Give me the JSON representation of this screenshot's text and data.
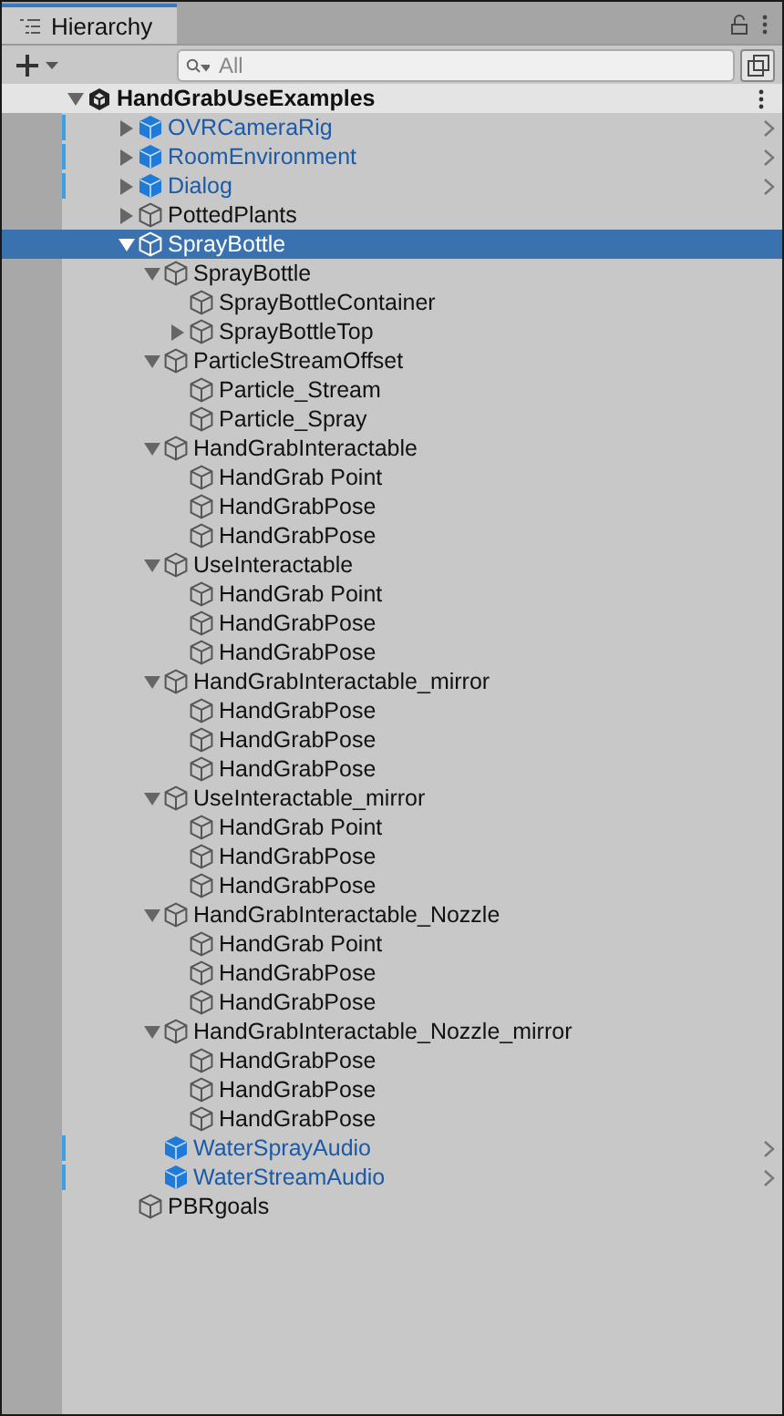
{
  "tab": {
    "title": "Hierarchy",
    "selected": true
  },
  "toolbar": {
    "search_placeholder": "All"
  },
  "scene": {
    "name": "HandGrabUseExamples",
    "expanded": true,
    "items": [
      {
        "name": "OVRCameraRig",
        "kind": "prefab",
        "expanded": false,
        "selected": false
      },
      {
        "name": "RoomEnvironment",
        "kind": "prefab",
        "expanded": false,
        "selected": false
      },
      {
        "name": "Dialog",
        "kind": "prefab",
        "expanded": false,
        "selected": false
      },
      {
        "name": "PottedPlants",
        "kind": "object",
        "expanded": false,
        "selected": false
      },
      {
        "name": "SprayBottle",
        "kind": "object",
        "expanded": true,
        "selected": true,
        "children": [
          {
            "name": "SprayBottle",
            "kind": "object",
            "expanded": true,
            "selected": false,
            "children": [
              {
                "name": "SprayBottleContainer",
                "kind": "object",
                "selected": false
              },
              {
                "name": "SprayBottleTop",
                "kind": "object",
                "expanded": false,
                "selected": false
              }
            ]
          },
          {
            "name": "ParticleStreamOffset",
            "kind": "object",
            "expanded": true,
            "selected": false,
            "children": [
              {
                "name": "Particle_Stream",
                "kind": "object",
                "selected": false
              },
              {
                "name": "Particle_Spray",
                "kind": "object",
                "selected": false
              }
            ]
          },
          {
            "name": "HandGrabInteractable",
            "kind": "object",
            "expanded": true,
            "selected": false,
            "children": [
              {
                "name": "HandGrab Point",
                "kind": "object",
                "selected": false
              },
              {
                "name": "HandGrabPose",
                "kind": "object",
                "selected": false
              },
              {
                "name": "HandGrabPose",
                "kind": "object",
                "selected": false
              }
            ]
          },
          {
            "name": "UseInteractable",
            "kind": "object",
            "expanded": true,
            "selected": false,
            "children": [
              {
                "name": "HandGrab Point",
                "kind": "object",
                "selected": false
              },
              {
                "name": "HandGrabPose",
                "kind": "object",
                "selected": false
              },
              {
                "name": "HandGrabPose",
                "kind": "object",
                "selected": false
              }
            ]
          },
          {
            "name": "HandGrabInteractable_mirror",
            "kind": "object",
            "expanded": true,
            "selected": false,
            "children": [
              {
                "name": "HandGrabPose",
                "kind": "object",
                "selected": false
              },
              {
                "name": "HandGrabPose",
                "kind": "object",
                "selected": false
              },
              {
                "name": "HandGrabPose",
                "kind": "object",
                "selected": false
              }
            ]
          },
          {
            "name": "UseInteractable_mirror",
            "kind": "object",
            "expanded": true,
            "selected": false,
            "children": [
              {
                "name": "HandGrab Point",
                "kind": "object",
                "selected": false
              },
              {
                "name": "HandGrabPose",
                "kind": "object",
                "selected": false
              },
              {
                "name": "HandGrabPose",
                "kind": "object",
                "selected": false
              }
            ]
          },
          {
            "name": "HandGrabInteractable_Nozzle",
            "kind": "object",
            "expanded": true,
            "selected": false,
            "children": [
              {
                "name": "HandGrab Point",
                "kind": "object",
                "selected": false
              },
              {
                "name": "HandGrabPose",
                "kind": "object",
                "selected": false
              },
              {
                "name": "HandGrabPose",
                "kind": "object",
                "selected": false
              }
            ]
          },
          {
            "name": "HandGrabInteractable_Nozzle_mirror",
            "kind": "object",
            "expanded": true,
            "selected": false,
            "children": [
              {
                "name": "HandGrabPose",
                "kind": "object",
                "selected": false
              },
              {
                "name": "HandGrabPose",
                "kind": "object",
                "selected": false
              },
              {
                "name": "HandGrabPose",
                "kind": "object",
                "selected": false
              }
            ]
          },
          {
            "name": "WaterSprayAudio",
            "kind": "prefab",
            "selected": false
          },
          {
            "name": "WaterStreamAudio",
            "kind": "prefab",
            "selected": false
          }
        ]
      },
      {
        "name": "PBRgoals",
        "kind": "object",
        "selected": false
      }
    ]
  }
}
